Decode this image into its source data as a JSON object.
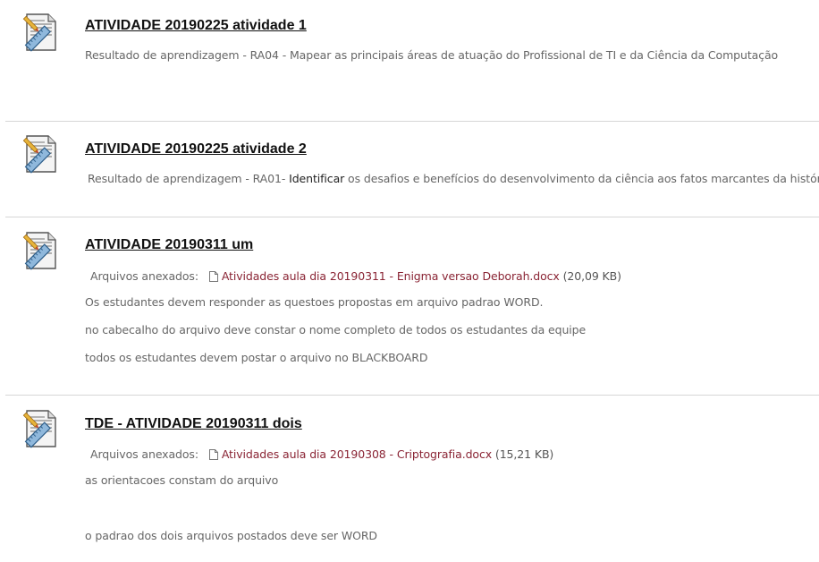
{
  "items": [
    {
      "title": "ATIVIDADE 20190225 atividade 1",
      "icon": "assignment-icon",
      "description": "Resultado de aprendizagem - RA04 - Mapear as principais áreas de atuação do Profissional de TI e da Ciência da Computação"
    },
    {
      "title": "ATIVIDADE 20190225 atividade 2",
      "icon": "assignment-icon",
      "description_prefix": "Resultado de aprendizagem - RA01- ",
      "description_highlight": "Identificar",
      "description_suffix": " os desafios e benefícios do desenvolvimento da ciência aos fatos marcantes da história."
    },
    {
      "title": "ATIVIDADE 20190311 um",
      "icon": "assignment-icon",
      "attachments_label": "Arquivos anexados:",
      "attachment_name": "Atividades aula dia 20190311 - Enigma versao Deborah.docx",
      "attachment_size": "(20,09 KB)",
      "lines": [
        "Os estudantes devem responder as questoes propostas em arquivo padrao WORD.",
        "no cabecalho do arquivo deve constar o nome completo de todos os estudantes da equipe",
        "todos os estudantes devem postar o arquivo no BLACKBOARD"
      ]
    },
    {
      "title": "TDE - ATIVIDADE 20190311 dois",
      "icon": "assignment-icon",
      "attachments_label": "Arquivos anexados:",
      "attachment_name": "Atividades aula dia 20190308 - Criptografia.docx",
      "attachment_size": "(15,21 KB)",
      "lines": [
        "as orientacoes constam do arquivo",
        "o padrao dos dois arquivos postados deve ser WORD"
      ]
    }
  ],
  "colors": {
    "title": "#111111",
    "body_text": "#666666",
    "link": "#8a2434",
    "divider": "#d6d6d6"
  }
}
